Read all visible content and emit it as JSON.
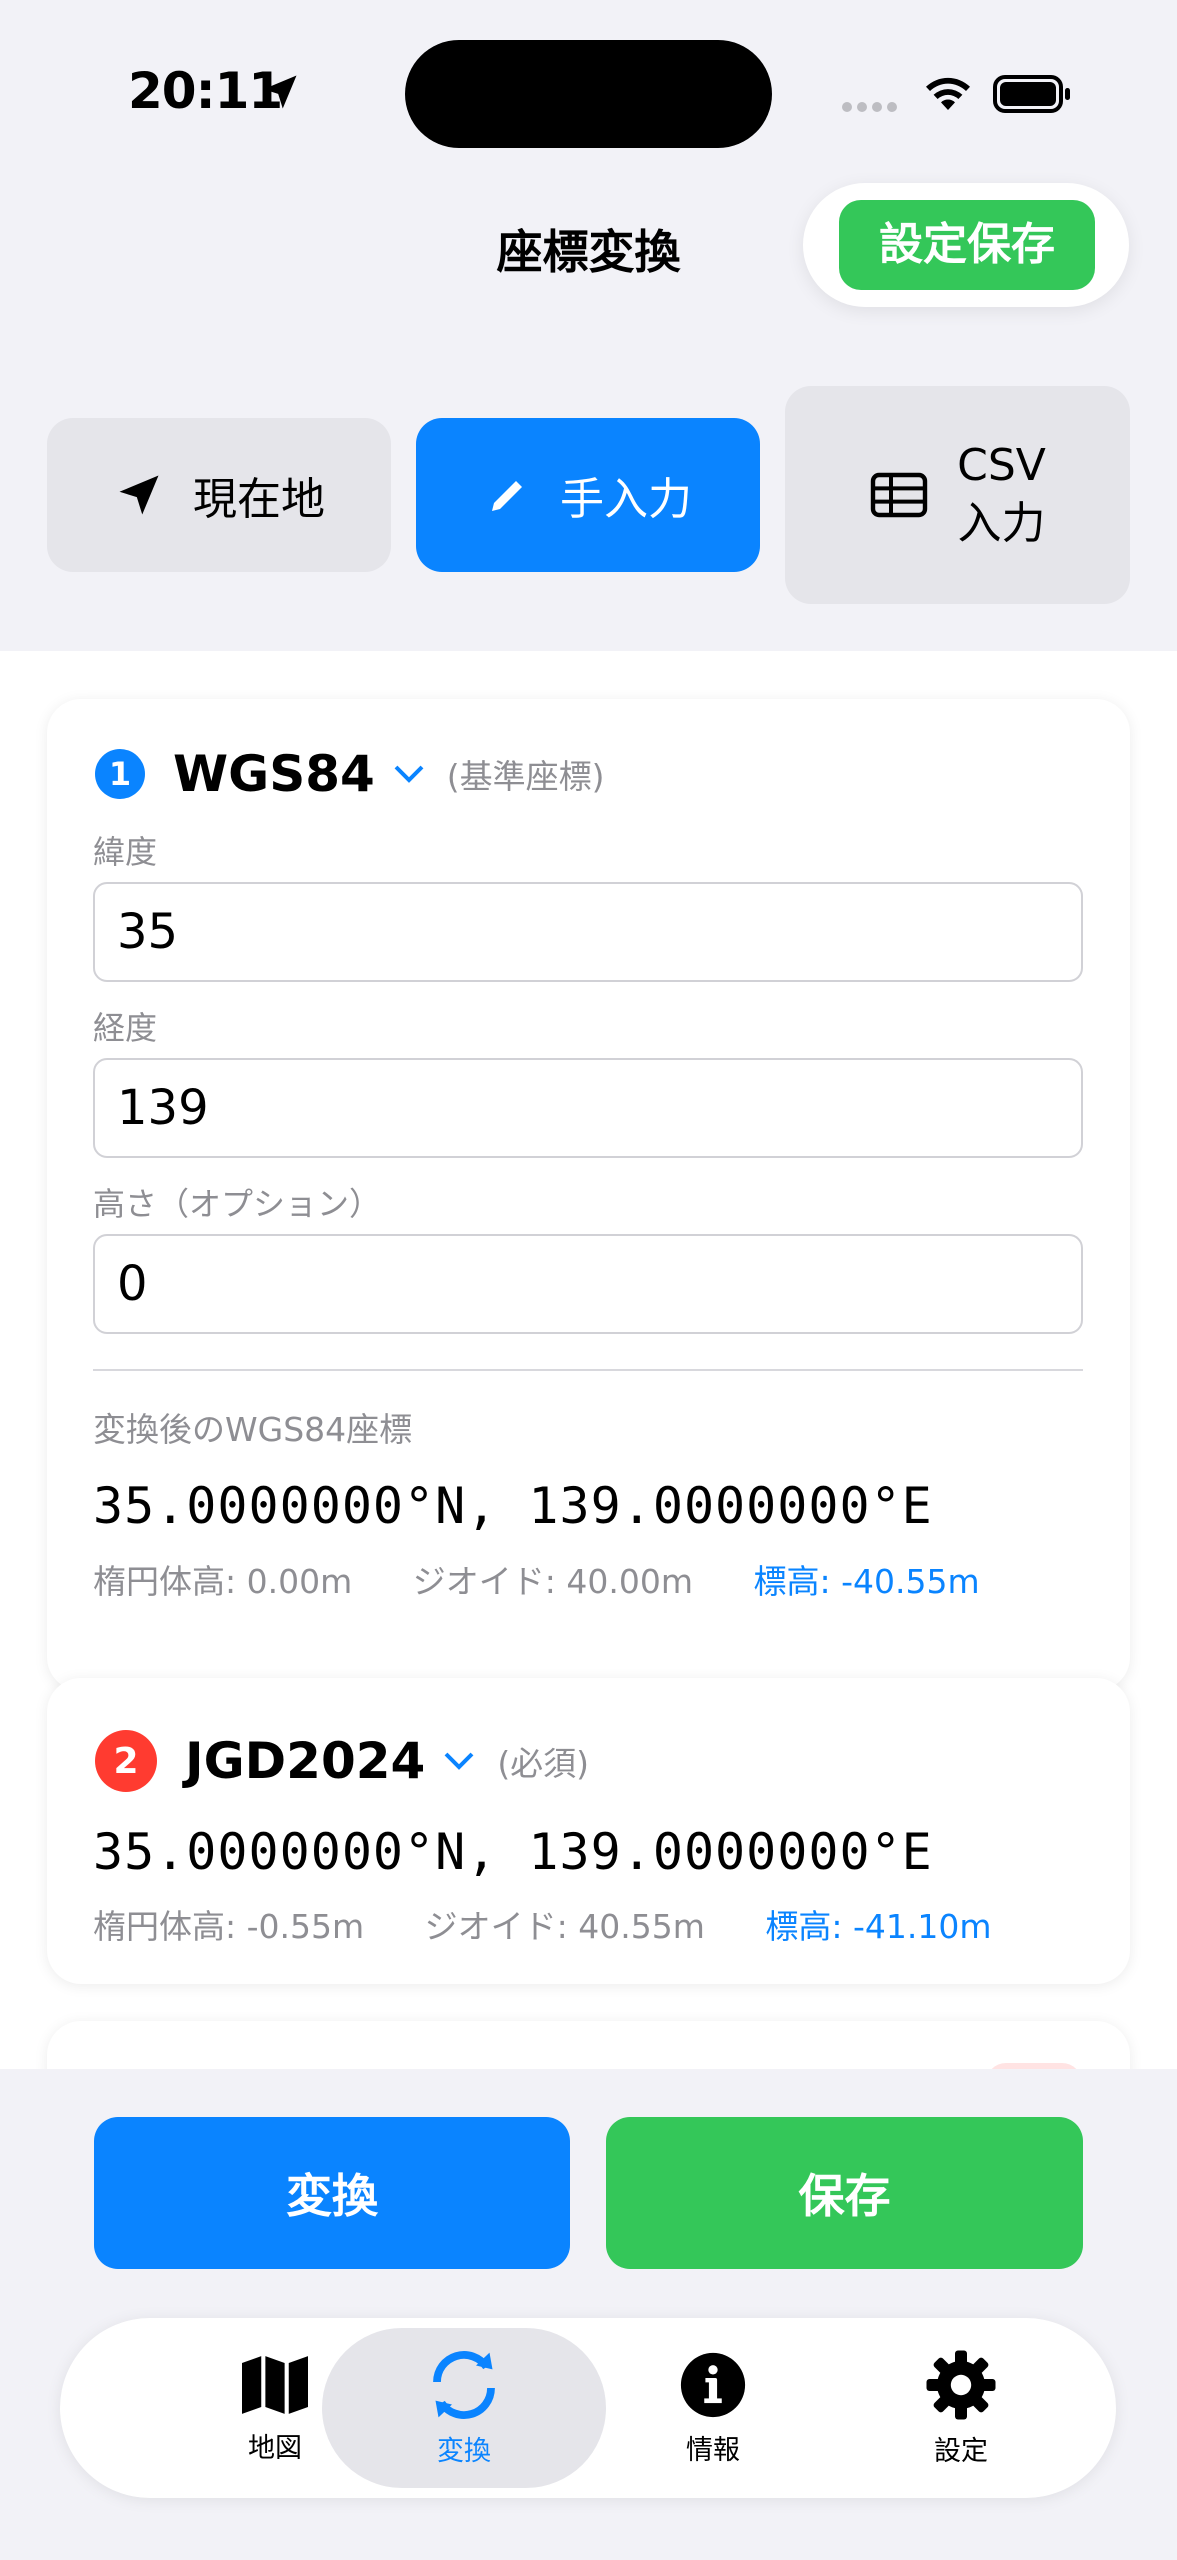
{
  "status": {
    "time": "20:11"
  },
  "header": {
    "title": "座標変換",
    "save_settings_label": "設定保存"
  },
  "modes": [
    {
      "label": "現在地",
      "icon": "location-arrow-icon",
      "active": false
    },
    {
      "label": "手入力",
      "icon": "pencil-icon",
      "active": true
    },
    {
      "label_line1": "CSV",
      "label_line2": "入力",
      "icon": "table-icon",
      "active": false
    }
  ],
  "card1": {
    "number": "1",
    "system": "WGS84",
    "note": "(基準座標)",
    "latitude_label": "緯度",
    "latitude_value": "35",
    "longitude_label": "経度",
    "longitude_value": "139",
    "height_label": "高さ（オプション）",
    "height_value": "0",
    "result_label": "変換後のWGS84座標",
    "coord": "35.0000000°N, 139.0000000°E",
    "ellipsoid_height": "楕円体高: 0.00m",
    "geoid": "ジオイド: 40.00m",
    "elevation": "標高: -40.55m"
  },
  "card2": {
    "number": "2",
    "system": "JGD2024",
    "note": "(必須)",
    "coord": "35.0000000°N, 139.0000000°E",
    "ellipsoid_height": "楕円体高: -0.55m",
    "geoid": "ジオイド: 40.55m",
    "elevation": "標高: -41.10m"
  },
  "actions": {
    "convert_label": "変換",
    "save_label": "保存"
  },
  "tabbar": {
    "items": [
      {
        "label": "地図",
        "icon": "map-icon",
        "active": false
      },
      {
        "label": "変換",
        "icon": "convert-arrows-icon",
        "active": true
      },
      {
        "label": "情報",
        "icon": "info-icon",
        "active": false
      },
      {
        "label": "設定",
        "icon": "gear-icon",
        "active": false
      }
    ]
  },
  "colors": {
    "accent_blue": "#0A84FF",
    "accent_green": "#34C759",
    "badge_red": "#FF3B30",
    "background": "#F2F2F7"
  }
}
